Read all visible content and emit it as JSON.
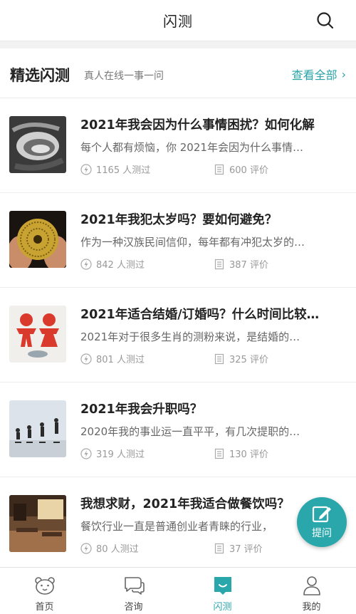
{
  "header": {
    "title": "闪测"
  },
  "section": {
    "title": "精选闪测",
    "subtitle": "真人在线一事一问",
    "more_label": "查看全部"
  },
  "items": [
    {
      "title": "2021年我会因为什么事情困扰？如何化解",
      "desc": "每个人都有烦恼，你 2021年会因为什么事情…",
      "tested": "1165 人测过",
      "reviews": "600 评价"
    },
    {
      "title": "2021年我犯太岁吗？要如何避免？",
      "desc": "作为一种汉族民间信仰，每年都有冲犯太岁的…",
      "tested": "842 人测过",
      "reviews": "387 评价"
    },
    {
      "title": "2021年适合结婚/订婚吗？什么时间比较…",
      "desc": "2021年对于很多生肖的测粉来说，是结婚的…",
      "tested": "801 人测过",
      "reviews": "325 评价"
    },
    {
      "title": "2021年我会升职吗？",
      "desc": "2020年我的事业运一直平平，有几次提职的…",
      "tested": "319 人测过",
      "reviews": "130 评价"
    },
    {
      "title": "我想求财，2021年我适合做餐饮吗？",
      "desc": "餐饮行业一直是普通创业者青睐的行业，",
      "tested": "80 人测过",
      "reviews": "37 评价"
    }
  ],
  "fab": {
    "label": "提问"
  },
  "tabs": [
    {
      "label": "首页"
    },
    {
      "label": "咨询"
    },
    {
      "label": "闪测"
    },
    {
      "label": "我的"
    }
  ],
  "colors": {
    "accent": "#2aa7ab",
    "link": "#2aa3a8"
  }
}
